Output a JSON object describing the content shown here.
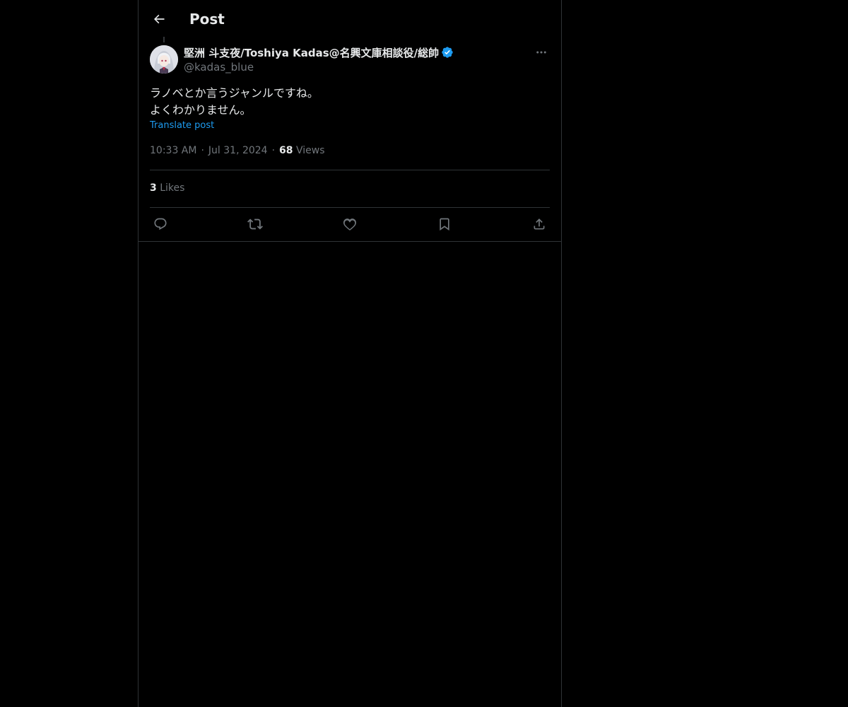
{
  "header": {
    "title": "Post",
    "back_icon": "arrow-left-icon"
  },
  "post": {
    "author": {
      "display_name": "堅洲 斗支夜/Toshiya Kadas@名興文庫相談役/総帥",
      "handle": "@kadas_blue",
      "verified": true
    },
    "text": "ラノベとか言うジャンルですね。\nよくわかりません。",
    "translate_label": "Translate post",
    "time": "10:33 AM",
    "date": "Jul 31, 2024",
    "views_count": "68",
    "views_label": "Views",
    "likes_count": "3",
    "likes_label": "Likes"
  },
  "actions": [
    {
      "icon": "reply-icon"
    },
    {
      "icon": "repost-icon"
    },
    {
      "icon": "like-icon"
    },
    {
      "icon": "bookmark-icon"
    },
    {
      "icon": "share-icon"
    }
  ],
  "colors": {
    "background": "#000000",
    "text": "#e7e9ea",
    "muted": "#71767b",
    "accent": "#1d9bf0",
    "border": "#2f3336"
  }
}
